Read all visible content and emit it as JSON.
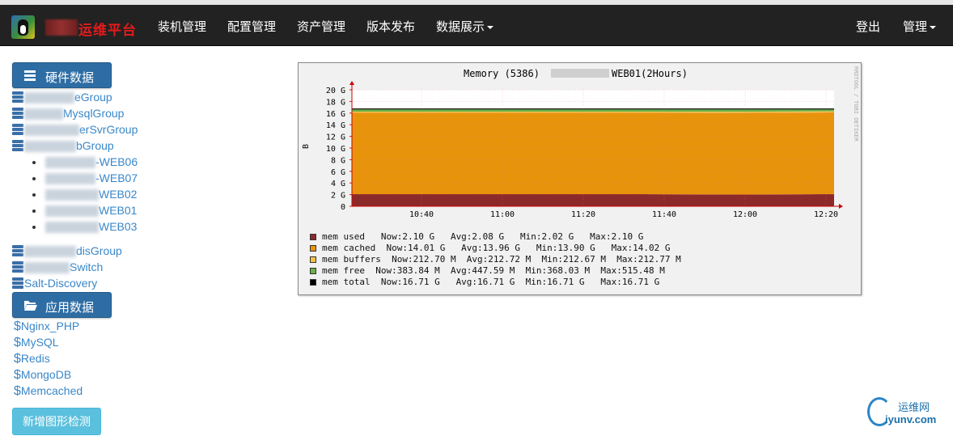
{
  "navbar": {
    "brand": "运维平台",
    "items": [
      "装机管理",
      "配置管理",
      "资产管理",
      "版本发布"
    ],
    "dropdown": "数据展示",
    "logout": "登出",
    "admin": "管理"
  },
  "sidebar": {
    "hardware_label": "硬件数据",
    "groups": [
      {
        "suffix": "eGroup"
      },
      {
        "suffix": "MysqlGroup"
      },
      {
        "suffix": "erSvrGroup"
      },
      {
        "suffix": "bGroup"
      }
    ],
    "hosts": [
      "-WEB06",
      "-WEB07",
      "WEB02",
      "WEB01",
      "WEB03"
    ],
    "groups2": [
      {
        "suffix": "disGroup"
      },
      {
        "suffix": "Switch"
      }
    ],
    "discovery": "Salt-Discovery",
    "app_label": "应用数据",
    "apps": [
      "Nginx_PHP",
      "MySQL",
      "Redis",
      "MongoDB",
      "Memcached"
    ],
    "add_button": "新增图形检测"
  },
  "graph": {
    "title_left": "Memory (5386) ",
    "title_right": "WEB01(2Hours)",
    "ylabel": "B",
    "side_label": "RRDTOOL / TOBI OETIKER",
    "colors": {
      "used": "#8c2a2a",
      "cached": "#e8930c",
      "buffers": "#f2c14a",
      "free": "#6ab04c",
      "total": "#000000"
    },
    "legend": [
      {
        "key": "used",
        "text": "mem used   Now:2.10 G   Avg:2.08 G   Min:2.02 G   Max:2.10 G"
      },
      {
        "key": "cached",
        "text": "mem cached  Now:14.01 G   Avg:13.96 G   Min:13.90 G   Max:14.02 G"
      },
      {
        "key": "buffers",
        "text": "mem buffers  Now:212.70 M  Avg:212.72 M  Min:212.67 M  Max:212.77 M"
      },
      {
        "key": "free",
        "text": "mem free  Now:383.84 M  Avg:447.59 M  Min:368.03 M  Max:515.48 M"
      },
      {
        "key": "total",
        "text": "mem total  Now:16.71 G   Avg:16.71 G  Min:16.71 G   Max:16.71 G"
      }
    ]
  },
  "chart_data": {
    "type": "area",
    "title": "Memory (5386) WEB01(2Hours)",
    "ylabel": "B",
    "ylim": [
      0,
      20
    ],
    "yticks": [
      "0",
      "2 G",
      "4 G",
      "6 G",
      "8 G",
      "10 G",
      "12 G",
      "14 G",
      "16 G",
      "18 G",
      "20 G"
    ],
    "x": [
      "10:40",
      "11:00",
      "11:20",
      "11:40",
      "12:00",
      "12:20"
    ],
    "series": [
      {
        "name": "mem used",
        "values": [
          2.08,
          2.08,
          2.08,
          2.08,
          2.02,
          2.1
        ]
      },
      {
        "name": "mem cached",
        "values": [
          13.96,
          13.96,
          13.96,
          13.96,
          14.0,
          14.01
        ]
      },
      {
        "name": "mem buffers",
        "values": [
          0.21,
          0.21,
          0.21,
          0.21,
          0.21,
          0.21
        ]
      },
      {
        "name": "mem free",
        "values": [
          0.45,
          0.45,
          0.45,
          0.45,
          0.45,
          0.38
        ]
      },
      {
        "name": "mem total",
        "values": [
          16.71,
          16.71,
          16.71,
          16.71,
          16.71,
          16.71
        ]
      }
    ]
  },
  "watermark": {
    "line1": "运维网",
    "line2": "iyunv.com"
  }
}
